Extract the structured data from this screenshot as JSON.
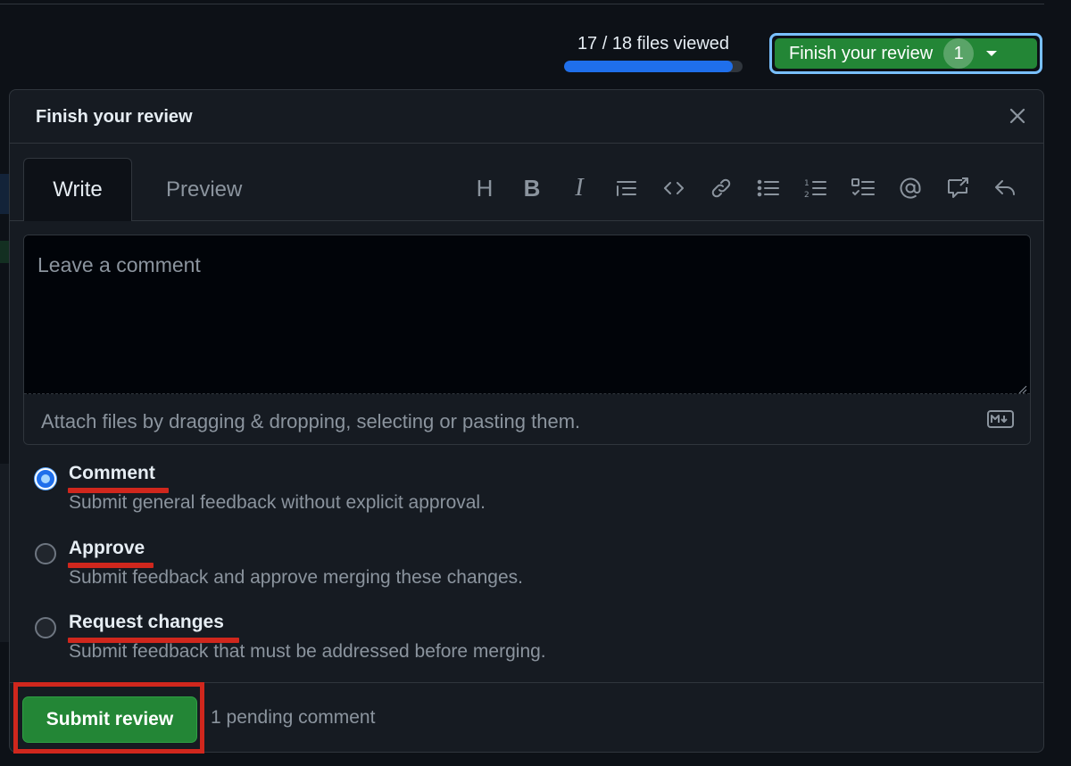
{
  "progress": {
    "text": "17 / 18 files viewed",
    "viewed": 17,
    "total": 18,
    "fraction": 0.944
  },
  "finish_button": {
    "label": "Finish your review",
    "count": "1"
  },
  "panel": {
    "title": "Finish your review"
  },
  "tabs": {
    "write": "Write",
    "preview": "Preview"
  },
  "toolbar": {
    "heading": "H",
    "bold": "B",
    "italic": "I",
    "icons": [
      "heading-icon",
      "bold-icon",
      "italic-icon",
      "quote-icon",
      "code-icon",
      "link-icon",
      "unordered-list-icon",
      "ordered-list-icon",
      "task-list-icon",
      "mention-icon",
      "reference-icon",
      "reply-icon"
    ]
  },
  "editor": {
    "placeholder": "Leave a comment",
    "attach_text": "Attach files by dragging & dropping, selecting or pasting them."
  },
  "options": [
    {
      "label": "Comment",
      "description": "Submit general feedback without explicit approval.",
      "checked": true
    },
    {
      "label": "Approve",
      "description": "Submit feedback and approve merging these changes.",
      "checked": false
    },
    {
      "label": "Request changes",
      "description": "Submit feedback that must be addressed before merging.",
      "checked": false
    }
  ],
  "footer": {
    "submit_label": "Submit review",
    "pending_text": "1 pending comment"
  },
  "colors": {
    "accent_green": "#238636",
    "annotation_red": "#d0271d",
    "progress_blue": "#1f6feb"
  }
}
